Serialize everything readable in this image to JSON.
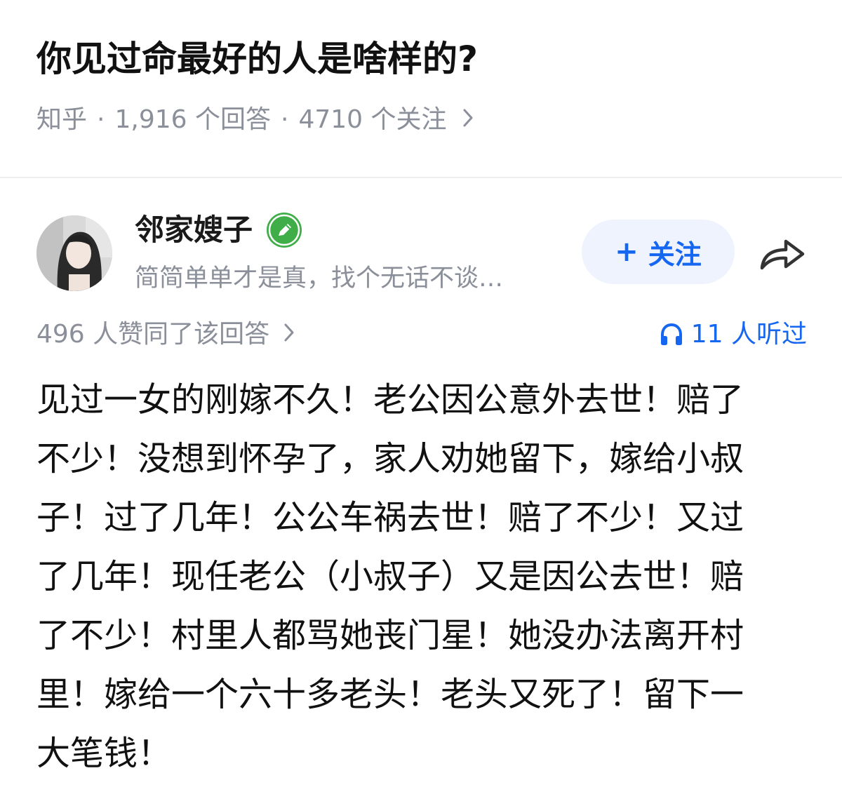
{
  "question": {
    "title": "你见过命最好的人是啥样的?",
    "source": "知乎",
    "answers_count": "1,916 个回答",
    "followers_count": "4710 个关注"
  },
  "author": {
    "name": "邻家嫂子",
    "signature": "简简单单才是真，找个无话不谈…",
    "follow_label": "关注"
  },
  "stats": {
    "likes_text": "496 人赞同了该回答",
    "listen_text": "11 人听过"
  },
  "answer": {
    "lines": [
      "见过一女的刚嫁不久！老公因公意外去世！赔了",
      "不少！没想到怀孕了，家人劝她留下，嫁给小叔",
      "子！过了几年！公公车祸去世！赔了不少！又过",
      "了几年！现任老公（小叔子）又是因公去世！赔",
      "了不少！村里人都骂她丧门星！她没办法离开村",
      "里！嫁给一个六十多老头！老头又死了！留下一",
      "大笔钱！"
    ]
  },
  "icons": {
    "badge": "green-pen-badge-icon",
    "share": "share-arrow-icon",
    "headphone": "headphone-icon",
    "chevron": "chevron-right-icon"
  },
  "colors": {
    "accent": "#1566f0",
    "follow_bg": "#eef3fe",
    "meta_gray": "#8a8f99",
    "badge_green": "#3fae49"
  }
}
